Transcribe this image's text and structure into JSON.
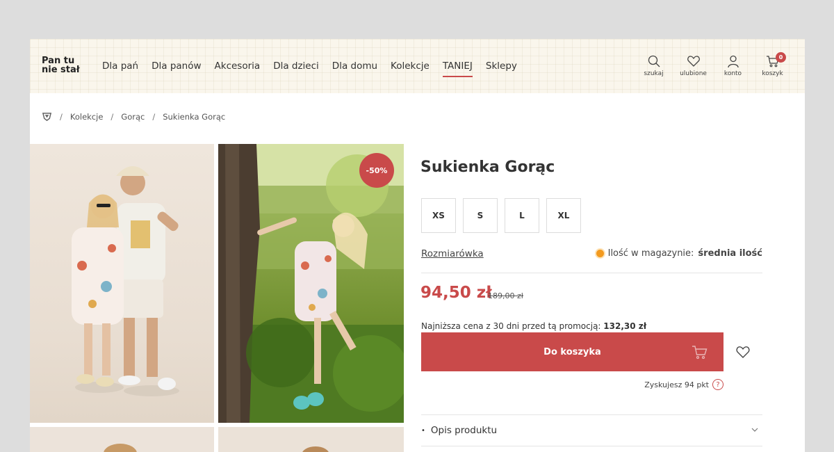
{
  "header": {
    "logo_line1": "Pan tu",
    "logo_line2": "nie stał",
    "nav": [
      {
        "label": "Dla pań"
      },
      {
        "label": "Dla panów"
      },
      {
        "label": "Akcesoria"
      },
      {
        "label": "Dla dzieci"
      },
      {
        "label": "Dla domu"
      },
      {
        "label": "Kolekcje"
      },
      {
        "label": "TANIEJ"
      },
      {
        "label": "Sklepy"
      }
    ],
    "actions": {
      "search": "szukaj",
      "favorites": "ulubione",
      "account": "konto",
      "cart": "koszyk",
      "cart_count": "0"
    }
  },
  "breadcrumb": [
    "Kolekcje",
    "Gorąc",
    "Sukienka Gorąc"
  ],
  "product": {
    "title": "Sukienka Gorąc",
    "discount_badge": "-50%",
    "sizes": [
      "XS",
      "S",
      "L",
      "XL"
    ],
    "size_chart_label": "Rozmiarówka",
    "stock_label": "Ilość w magazynie:",
    "stock_value": "średnia ilość",
    "price": "94,50 zł",
    "old_price": "189,00 zł",
    "lowest_price_label": "Najniższa cena z 30 dni przed tą promocją:",
    "lowest_price_value": "132,30 zł",
    "add_to_cart_label": "Do koszyka",
    "points_label": "Zyskujesz 94 pkt",
    "points_help": "?",
    "description_label": "Opis produktu"
  },
  "colors": {
    "accent": "#c94a4a",
    "stock_dot": "#f39a1f",
    "header_bg": "#faf6ec"
  }
}
